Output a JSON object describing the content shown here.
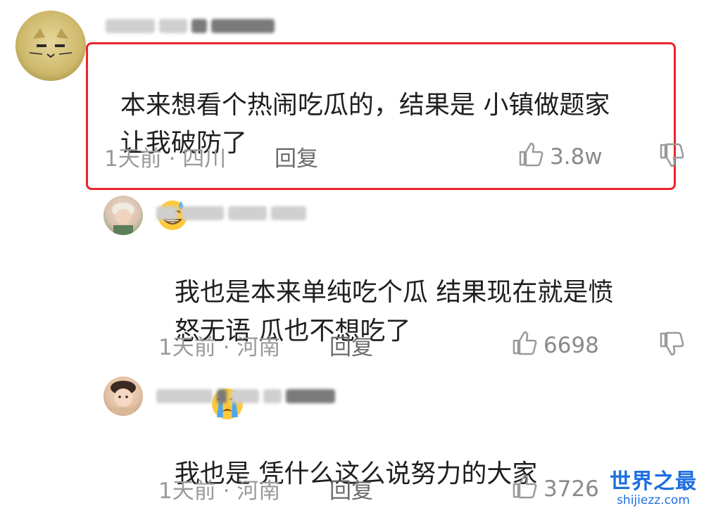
{
  "comments": [
    {
      "text_line1": "本来想看个热闹吃瓜的，结果是 小镇做题家",
      "text_line2": "让我破防了",
      "emoji": "grinning-sweat-emoji",
      "time_location": "1天前 · 四川",
      "reply_label": "回复",
      "likes": "3.8w",
      "highlighted": true
    },
    {
      "text_line1": "我也是本来单纯吃个瓜 结果现在就是愤",
      "text_line2": "怒无语 瓜也不想吃了",
      "emoji": "crying-emoji",
      "time_location": "1天前 · 河南",
      "reply_label": "回复",
      "likes": "6698"
    },
    {
      "text_line1": "我也是 凭什么这么说努力的大家",
      "time_location": "1天前 · 河南",
      "reply_label": "回复",
      "likes": "3726"
    }
  ],
  "watermark": {
    "title": "世界之最",
    "url": "shijiezz.com"
  },
  "colors": {
    "highlight": "#e8262b",
    "meta": "#9a9a9a",
    "watermark": "#1e6fe0"
  }
}
